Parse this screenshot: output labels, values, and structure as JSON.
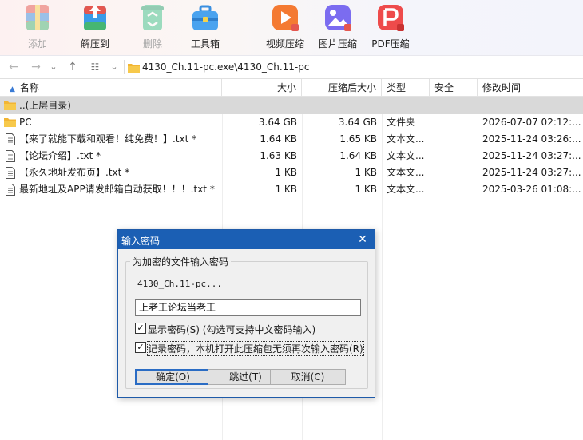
{
  "toolbar": {
    "add": "添加",
    "extract_to": "解压到",
    "delete": "删除",
    "toolbox": "工具箱",
    "video_compress": "视频压缩",
    "image_compress": "图片压缩",
    "pdf_compress": "PDF压缩"
  },
  "address": {
    "path": "4130_Ch.11-pc.exe\\4130_Ch.11-pc"
  },
  "columns": {
    "name": "名称",
    "size": "大小",
    "packed": "压缩后大小",
    "type": "类型",
    "security": "安全",
    "modified": "修改时间"
  },
  "rows": [
    {
      "name": "..(上层目录)",
      "size": "",
      "packed": "",
      "type": "",
      "security": "",
      "modified": ""
    },
    {
      "name": "PC",
      "size": "3.64 GB",
      "packed": "3.64 GB",
      "type": "文件夹",
      "security": "",
      "modified": "2026-07-07 02:12:..."
    },
    {
      "name": "【来了就能下载和观看！纯免费！】.txt *",
      "size": "1.64 KB",
      "packed": "1.65 KB",
      "type": "文本文...",
      "security": "",
      "modified": "2025-11-24 03:26:..."
    },
    {
      "name": "【论坛介绍】.txt *",
      "size": "1.63 KB",
      "packed": "1.64 KB",
      "type": "文本文...",
      "security": "",
      "modified": "2025-11-24 03:27:..."
    },
    {
      "name": "【永久地址发布页】.txt *",
      "size": "1 KB",
      "packed": "1 KB",
      "type": "文本文...",
      "security": "",
      "modified": "2025-11-24 03:27:..."
    },
    {
      "name": "最新地址及APP请发邮箱自动获取！！！.txt *",
      "size": "1 KB",
      "packed": "1 KB",
      "type": "文本文...",
      "security": "",
      "modified": "2025-03-26 01:08:..."
    }
  ],
  "dialog": {
    "title": "输入密码",
    "group_title": "为加密的文件输入密码",
    "filename": "4130_Ch.11-pc...",
    "password": "上老王论坛当老王",
    "show_password": "显示密码(S) (勾选可支持中文密码输入)",
    "remember_password": "记录密码，本机打开此压缩包无须再次输入密码(R)",
    "ok": "确定(O)",
    "skip": "跳过(T)",
    "cancel": "取消(C)"
  },
  "colors": {
    "dialog_title_bg": "#1b5fb4",
    "selected_row_bg": "#d9d9d9",
    "folder": "#f2b533"
  }
}
